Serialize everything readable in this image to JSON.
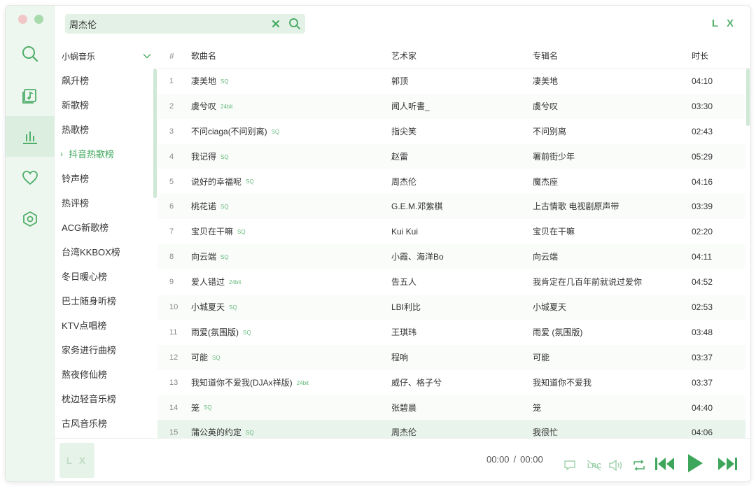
{
  "app": {
    "logo": "L X",
    "cover_text": "L X"
  },
  "search": {
    "value": "周杰伦"
  },
  "source": {
    "label": "小蜗音乐"
  },
  "boards": [
    {
      "label": "飙升榜"
    },
    {
      "label": "新歌榜"
    },
    {
      "label": "热歌榜"
    },
    {
      "label": "抖音热歌榜",
      "active": true
    },
    {
      "label": "铃声榜"
    },
    {
      "label": "热评榜"
    },
    {
      "label": "ACG新歌榜"
    },
    {
      "label": "台湾KKBOX榜"
    },
    {
      "label": "冬日暖心榜"
    },
    {
      "label": "巴士随身听榜"
    },
    {
      "label": "KTV点唱榜"
    },
    {
      "label": "家务进行曲榜"
    },
    {
      "label": "熬夜修仙榜"
    },
    {
      "label": "枕边轻音乐榜"
    },
    {
      "label": "古风音乐榜"
    }
  ],
  "table": {
    "headers": {
      "num": "#",
      "name": "歌曲名",
      "artist": "艺术家",
      "album": "专辑名",
      "time": "时长"
    },
    "rows": [
      {
        "num": "1",
        "name": "凄美地",
        "quality": "SQ",
        "artist": "郭顶",
        "album": "凄美地",
        "time": "04:10"
      },
      {
        "num": "2",
        "name": "虞兮叹",
        "quality": "24bit",
        "artist": "闻人听書_",
        "album": "虞兮叹",
        "time": "03:30"
      },
      {
        "num": "3",
        "name": "不问ciaga(不问别离)",
        "quality": "SQ",
        "artist": "指尖笑",
        "album": "不问别离",
        "time": "02:43"
      },
      {
        "num": "4",
        "name": "我记得",
        "quality": "SQ",
        "artist": "赵雷",
        "album": "署前街少年",
        "time": "05:29"
      },
      {
        "num": "5",
        "name": "说好的幸福呢",
        "quality": "SQ",
        "artist": "周杰伦",
        "album": "魔杰座",
        "time": "04:16"
      },
      {
        "num": "6",
        "name": "桃花诺",
        "quality": "SQ",
        "artist": "G.E.M.邓紫棋",
        "album": "上古情歌 电视剧原声带",
        "time": "03:39"
      },
      {
        "num": "7",
        "name": "宝贝在干嘛",
        "quality": "SQ",
        "artist": "Kui Kui",
        "album": "宝贝在干嘛",
        "time": "02:20"
      },
      {
        "num": "8",
        "name": "向云端",
        "quality": "SQ",
        "artist": "小霞、海洋Bo",
        "album": "向云端",
        "time": "04:11"
      },
      {
        "num": "9",
        "name": "爱人错过",
        "quality": "24bit",
        "artist": "告五人",
        "album": "我肯定在几百年前就说过爱你",
        "time": "04:52"
      },
      {
        "num": "10",
        "name": "小城夏天",
        "quality": "SQ",
        "artist": "LBI利比",
        "album": "小城夏天",
        "time": "02:53"
      },
      {
        "num": "11",
        "name": "雨爱(氛围版)",
        "quality": "SQ",
        "artist": "王琪玮",
        "album": "雨爱 (氛围版)",
        "time": "03:48"
      },
      {
        "num": "12",
        "name": "可能",
        "quality": "SQ",
        "artist": "程响",
        "album": "可能",
        "time": "03:37"
      },
      {
        "num": "13",
        "name": "我知道你不爱我(DJAx祥版)",
        "quality": "24bit",
        "artist": "威仔、格子兮",
        "album": "我知道你不爱我",
        "time": "03:37"
      },
      {
        "num": "14",
        "name": "笼",
        "quality": "SQ",
        "artist": "张碧晨",
        "album": "笼",
        "time": "04:40"
      },
      {
        "num": "15",
        "name": "蒲公英的约定",
        "quality": "SQ",
        "artist": "周杰伦",
        "album": "我很忙",
        "time": "04:06"
      }
    ]
  },
  "player": {
    "current_time": "00:00",
    "separator": "/",
    "total_time": "00:00"
  },
  "colors": {
    "accent": "#3ea65b",
    "rail_bg": "#eef6f0",
    "active_row": "#e9f4ec"
  }
}
